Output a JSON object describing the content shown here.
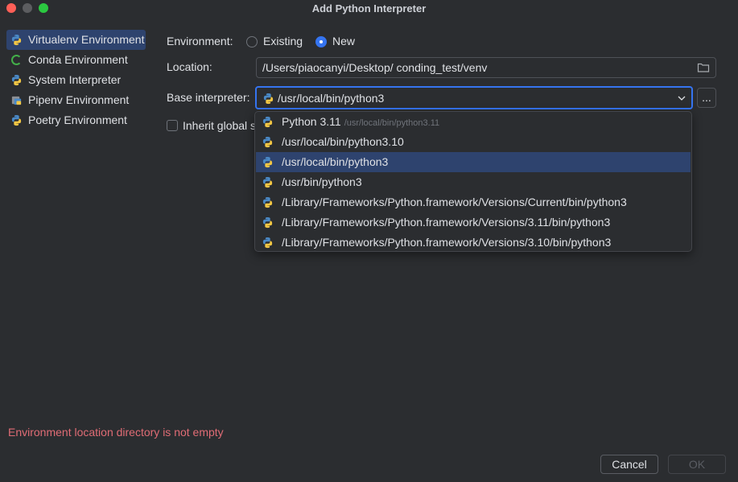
{
  "window": {
    "title": "Add Python Interpreter"
  },
  "sidebar": {
    "items": [
      {
        "label": "Virtualenv Environment",
        "icon": "python-icon",
        "selected": true
      },
      {
        "label": "Conda Environment",
        "icon": "conda-icon"
      },
      {
        "label": "System Interpreter",
        "icon": "python-icon"
      },
      {
        "label": "Pipenv Environment",
        "icon": "pipenv-icon"
      },
      {
        "label": "Poetry Environment",
        "icon": "python-icon"
      }
    ]
  },
  "form": {
    "environment_label": "Environment:",
    "existing_label": "Existing",
    "new_label": "New",
    "environment_selected": "New",
    "location_label": "Location:",
    "location_value": "/Users/piaocanyi/Desktop/ conding_test/venv",
    "base_interpreter_label": "Base interpreter:",
    "base_interpreter_value": "/usr/local/bin/python3",
    "browse_label": "...",
    "inherit_label": "Inherit global s"
  },
  "dropdown": {
    "items": [
      {
        "label": "Python 3.11",
        "sub": "/usr/local/bin/python3.11"
      },
      {
        "label": "/usr/local/bin/python3.10"
      },
      {
        "label": "/usr/local/bin/python3",
        "selected": true
      },
      {
        "label": "/usr/bin/python3"
      },
      {
        "label": "/Library/Frameworks/Python.framework/Versions/Current/bin/python3"
      },
      {
        "label": "/Library/Frameworks/Python.framework/Versions/3.11/bin/python3"
      },
      {
        "label": "/Library/Frameworks/Python.framework/Versions/3.10/bin/python3"
      }
    ]
  },
  "error_message": "Environment location directory is not empty",
  "buttons": {
    "cancel": "Cancel",
    "ok": "OK"
  },
  "colors": {
    "background": "#2b2d30",
    "accent": "#3574f0",
    "selection": "#2e436e",
    "error": "#e06c75"
  }
}
